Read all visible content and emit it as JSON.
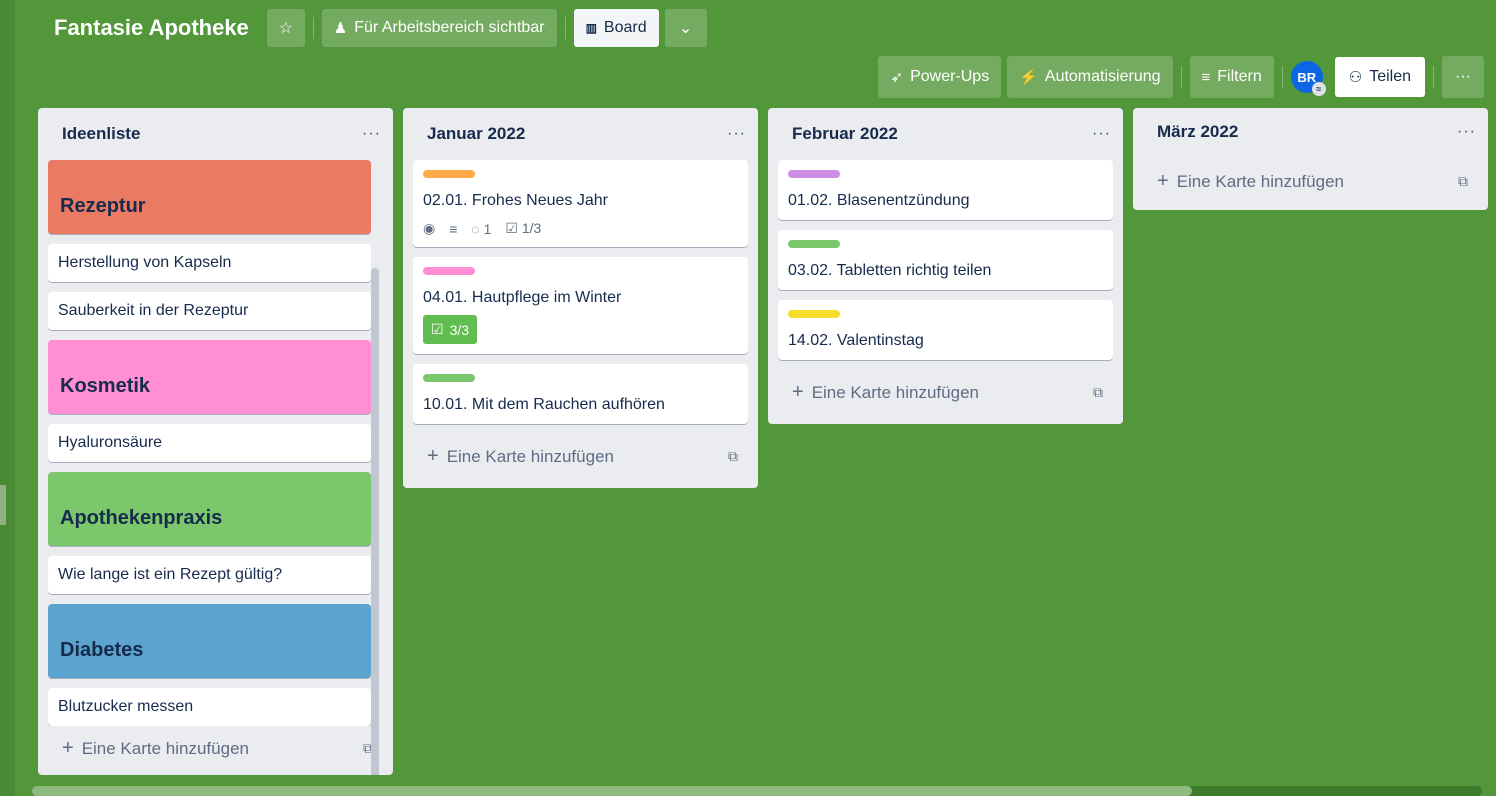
{
  "colors": {
    "board_bg": "#52973a",
    "rezeptur": "#eb7a63",
    "kosmetik": "#ff8ed4",
    "apothekenpraxis": "#7bc86c",
    "diabetes": "#5ba4cf",
    "label_orange": "#ffab4a",
    "label_pink": "#ff8ed4",
    "label_green": "#7bc86c",
    "label_purple": "#cd8de5",
    "label_yellow": "#f5dd29"
  },
  "header": {
    "board_name": "Fantasie Apotheke",
    "star_icon": "star-icon",
    "visibility": "Für Arbeitsbereich sichtbar",
    "view": "Board",
    "powerups": "Power-Ups",
    "automation": "Automatisierung",
    "filter": "Filtern",
    "avatar": "BR",
    "share": "Teilen"
  },
  "lists": [
    {
      "title": "Ideenliste",
      "cards": [
        {
          "type": "cover",
          "text": "Rezeptur",
          "color": "#eb7a63"
        },
        {
          "type": "card",
          "text": "Herstellung von Kapseln"
        },
        {
          "type": "card",
          "text": "Sauberkeit in der Rezeptur"
        },
        {
          "type": "cover",
          "text": "Kosmetik",
          "color": "#ff8ed4"
        },
        {
          "type": "card",
          "text": "Hyaluronsäure"
        },
        {
          "type": "cover",
          "text": "Apothekenpraxis",
          "color": "#7bc86c"
        },
        {
          "type": "card",
          "text": "Wie lange ist ein Rezept gültig?"
        },
        {
          "type": "cover",
          "text": "Diabetes",
          "color": "#5ba4cf"
        },
        {
          "type": "card",
          "text": "Blutzucker messen"
        }
      ],
      "add": "Eine Karte hinzufügen"
    },
    {
      "title": "Januar 2022",
      "cards": [
        {
          "type": "card",
          "text": "02.01. Frohes Neues Jahr",
          "label": "#ffab4a",
          "comments": "1",
          "checklist": "1/3"
        },
        {
          "type": "card",
          "text": "04.01. Hautpflege im Winter",
          "label": "#ff8ed4",
          "done": "3/3"
        },
        {
          "type": "card",
          "text": "10.01. Mit dem Rauchen aufhören",
          "label": "#7bc86c"
        }
      ],
      "add": "Eine Karte hinzufügen"
    },
    {
      "title": "Februar 2022",
      "cards": [
        {
          "type": "card",
          "text": "01.02. Blasenentzündung",
          "label": "#cd8de5"
        },
        {
          "type": "card",
          "text": "03.02. Tabletten richtig teilen",
          "label": "#7bc86c"
        },
        {
          "type": "card",
          "text": "14.02. Valentinstag",
          "label": "#f5dd29"
        }
      ],
      "add": "Eine Karte hinzufügen"
    },
    {
      "title": "März 2022",
      "cards": [],
      "add": "Eine Karte hinzufügen"
    }
  ]
}
